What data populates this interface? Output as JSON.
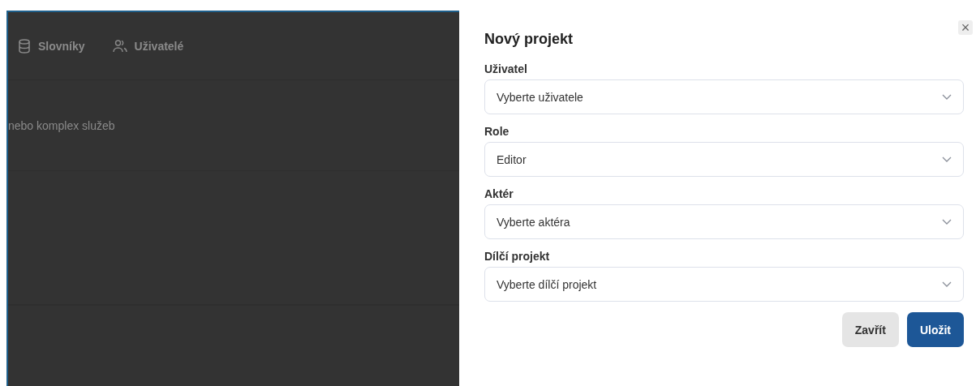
{
  "background": {
    "nav": [
      {
        "label": "Slovníky",
        "kind": "dictionary"
      },
      {
        "label": "Uživatelé",
        "kind": "users"
      }
    ],
    "rows": [
      "nebo komplex služeb"
    ]
  },
  "drawer": {
    "title": "Nový projekt",
    "close": "×",
    "fields": [
      {
        "label": "Uživatel",
        "placeholder": "Vyberte uživatele"
      },
      {
        "label": "Role",
        "value": "Editor"
      },
      {
        "label": "Aktér",
        "placeholder": "Vyberte aktéra"
      },
      {
        "label": "Dílčí projekt",
        "placeholder": "Vyberte dílčí projekt"
      }
    ],
    "buttons": [
      {
        "label": "Zavřít",
        "kind": "secondary"
      },
      {
        "label": "Uložit",
        "kind": "primary"
      }
    ]
  }
}
